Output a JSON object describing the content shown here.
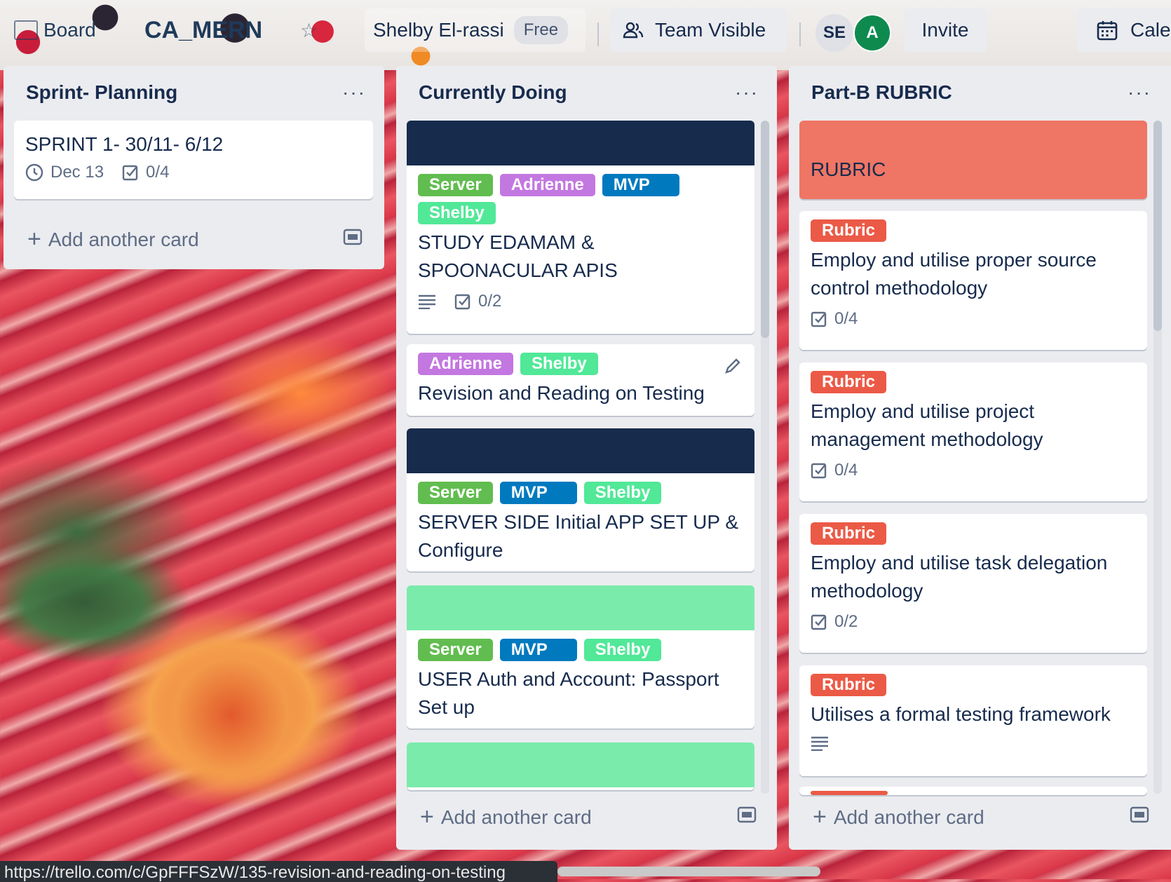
{
  "header": {
    "board_switch": "Board",
    "board_name": "CA_MERN",
    "team_name": "Shelby El-rassi",
    "plan": "Free",
    "visibility": "Team Visible",
    "members": [
      "SE",
      "A"
    ],
    "invite": "Invite",
    "calendar": "Cale"
  },
  "colors": {
    "green": "#61bd4f",
    "purple": "#c377e0",
    "blue": "#0079bf",
    "lime": "#51e898",
    "red": "#eb5a46",
    "navy": "#172b4d",
    "salmon": "#ef7564",
    "mint": "#7bebac"
  },
  "lists": [
    {
      "title": "Sprint- Planning",
      "menu": "···",
      "add_card": "Add another card",
      "cards": [
        {
          "title": "SPRINT 1- 30/11- 6/12",
          "due": "Dec 13",
          "checklist": "0/4"
        }
      ]
    },
    {
      "title": "Currently Doing",
      "menu": "···",
      "add_card": "Add another card",
      "cards": [
        {
          "cover": "navy",
          "labels": [
            "Server",
            "Adrienne",
            "MVP",
            "Shelby"
          ],
          "title": "STUDY EDAMAM & SPOONACULAR APIS",
          "checklist": "0/2"
        },
        {
          "labels": [
            "Adrienne",
            "Shelby"
          ],
          "title": "Revision and Reading on Testing"
        },
        {
          "cover": "navy",
          "labels": [
            "Server",
            "MVP",
            "Shelby"
          ],
          "title": "SERVER SIDE Initial APP SET UP & Configure"
        },
        {
          "cover": "mint",
          "labels": [
            "Server",
            "MVP",
            "Shelby"
          ],
          "title": "USER Auth and Account: Passport Set up"
        },
        {
          "cover": "mint"
        }
      ]
    },
    {
      "title": "Part-B RUBRIC",
      "menu": "···",
      "add_card": "Add another card",
      "cards": [
        {
          "cover": "salmon",
          "title": "RUBRIC"
        },
        {
          "labels": [
            "Rubric"
          ],
          "title": "Employ and utilise proper source control methodology",
          "checklist": "0/4"
        },
        {
          "labels": [
            "Rubric"
          ],
          "title": "Employ and utilise project management methodology",
          "checklist": "0/4"
        },
        {
          "labels": [
            "Rubric"
          ],
          "title": "Employ and utilise task delegation methodology",
          "checklist": "0/2"
        },
        {
          "labels": [
            "Rubric"
          ],
          "title": "Utilises a formal testing framework"
        }
      ]
    }
  ],
  "status_url": "https://trello.com/c/GpFFFSzW/135-revision-and-reading-on-testing"
}
